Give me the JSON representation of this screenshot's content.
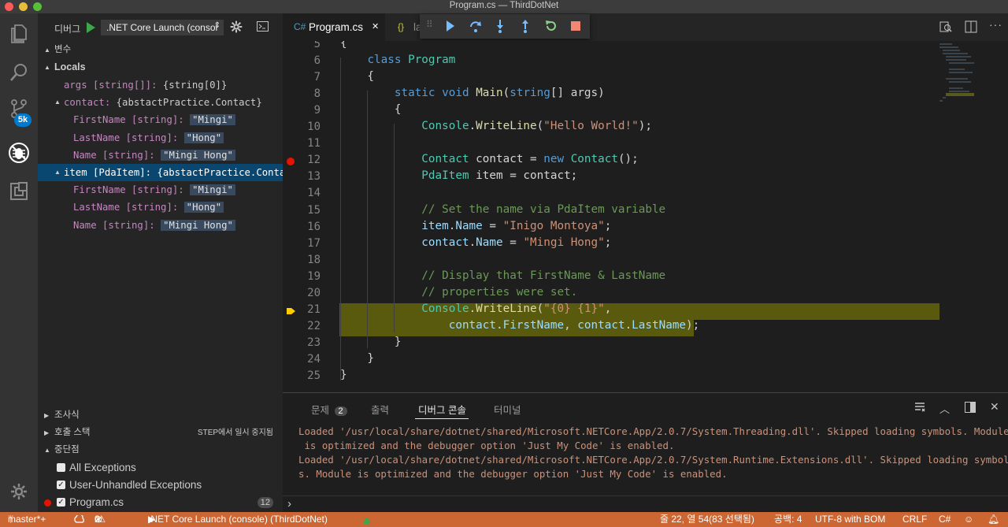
{
  "window": {
    "title": "Program.cs — ThirdDotNet"
  },
  "colors": {
    "accent": "#007acc",
    "status_bar": "#cc6633",
    "selection": "#094771",
    "current_line": "#5a5a0e"
  },
  "activity": {
    "icons": [
      "explorer-icon",
      "search-icon",
      "source-control-icon",
      "debug-icon",
      "extensions-icon",
      "settings-gear-icon"
    ],
    "scm_badge": "5k"
  },
  "debug_toolbar": {
    "label": "디버그",
    "configuration": ".NET Core Launch (consol"
  },
  "sidebar": {
    "variables_header": "변수",
    "locals_header": "Locals",
    "variables": [
      {
        "indent": 1,
        "expander": "",
        "name": "args [string[]]:",
        "value": "{string[0]}",
        "type": "plain"
      },
      {
        "indent": 1,
        "expander": "▲",
        "name": "contact:",
        "value": "{abstactPractice.Contact}",
        "type": "plain"
      },
      {
        "indent": 2,
        "expander": "",
        "name": "FirstName [string]:",
        "value": "\"Mingi\"",
        "type": "string"
      },
      {
        "indent": 2,
        "expander": "",
        "name": "LastName [string]:",
        "value": "\"Hong\"",
        "type": "string"
      },
      {
        "indent": 2,
        "expander": "",
        "name": "Name [string]:",
        "value": "\"Mingi Hong\"",
        "type": "string"
      },
      {
        "indent": 1,
        "expander": "▲",
        "name": "item [PdaItem]:",
        "value": "{abstactPractice.Contact}",
        "type": "plain",
        "selected": true
      },
      {
        "indent": 2,
        "expander": "",
        "name": "FirstName [string]:",
        "value": "\"Mingi\"",
        "type": "string"
      },
      {
        "indent": 2,
        "expander": "",
        "name": "LastName [string]:",
        "value": "\"Hong\"",
        "type": "string"
      },
      {
        "indent": 2,
        "expander": "",
        "name": "Name [string]:",
        "value": "\"Mingi Hong\"",
        "type": "string"
      }
    ],
    "watch_header": "조사식",
    "callstack_header": "호출 스택",
    "callstack_status": "STEP에서 일시 중지됨",
    "breakpoints_header": "중단점",
    "breakpoints": [
      {
        "label": "All Exceptions",
        "checked": false,
        "dot": false,
        "count": ""
      },
      {
        "label": "User-Unhandled Exceptions",
        "checked": true,
        "dot": false,
        "count": ""
      },
      {
        "label": "Program.cs",
        "checked": true,
        "dot": true,
        "count": "12"
      }
    ]
  },
  "editor": {
    "tabs": [
      {
        "label": "Program.cs",
        "icon": "csharp-file-icon",
        "active": true,
        "close": "✕"
      },
      {
        "label": "la",
        "icon": "json-file-icon",
        "active": false
      }
    ],
    "lines": [
      {
        "no": "5",
        "html": "{"
      },
      {
        "no": "6",
        "html": "    <span class=\"kw\">class</span> <span class=\"ty\">Program</span>"
      },
      {
        "no": "7",
        "html": "    {"
      },
      {
        "no": "8",
        "html": "        <span class=\"kw\">static</span> <span class=\"kw\">void</span> <span class=\"fn\">Main</span>(<span class=\"kw\">string</span>[] args)"
      },
      {
        "no": "9",
        "html": "        {"
      },
      {
        "no": "10",
        "html": "            <span class=\"ty\">Console</span>.<span class=\"fn\">WriteLine</span>(<span class=\"s\">\"Hello World!\"</span>);"
      },
      {
        "no": "11",
        "html": ""
      },
      {
        "no": "12",
        "html": "            <span class=\"ty\">Contact</span> contact = <span class=\"kw\">new</span> <span class=\"ty\">Contact</span>();",
        "breakpoint": true
      },
      {
        "no": "13",
        "html": "            <span class=\"ty\">PdaItem</span> item = contact;"
      },
      {
        "no": "14",
        "html": ""
      },
      {
        "no": "15",
        "html": "            <span class=\"c\">// Set the name via PdaItem variable</span>"
      },
      {
        "no": "16",
        "html": "            <span class=\"id\">item</span>.<span class=\"id\">Name</span> = <span class=\"s\">\"Inigo Montoya\"</span>;"
      },
      {
        "no": "17",
        "html": "            <span class=\"id\">contact</span>.<span class=\"id\">Name</span> = <span class=\"s\">\"Mingi Hong\"</span>;"
      },
      {
        "no": "18",
        "html": ""
      },
      {
        "no": "19",
        "html": "            <span class=\"c\">// Display that FirstName &amp; LastName</span>"
      },
      {
        "no": "20",
        "html": "            <span class=\"c\">// properties were set.</span>"
      },
      {
        "no": "21",
        "html": "            <span class=\"ty\">Console</span>.<span class=\"fn\">WriteLine</span>(<span class=\"s\">\"{0} {1}\"</span>,",
        "current": true
      },
      {
        "no": "22",
        "html": "                <span class=\"id\">contact</span>.<span class=\"id\">FirstName</span>, <span class=\"id\">contact</span>.<span class=\"id\">LastName</span>);",
        "current": true
      },
      {
        "no": "23",
        "html": "        }"
      },
      {
        "no": "24",
        "html": "    }"
      },
      {
        "no": "25",
        "html": "}"
      }
    ]
  },
  "panel": {
    "tabs": [
      {
        "label": "문제",
        "badge": "2"
      },
      {
        "label": "출력"
      },
      {
        "label": "디버그 콘솔",
        "active": true
      },
      {
        "label": "터미널"
      }
    ],
    "output": [
      "Loaded '/usr/local/share/dotnet/shared/Microsoft.NETCore.App/2.0.7/System.Threading.dll'. Skipped loading symbols. Module",
      " is optimized and the debugger option 'Just My Code' is enabled.",
      "Loaded '/usr/local/share/dotnet/shared/Microsoft.NETCore.App/2.0.7/System.Runtime.Extensions.dll'. Skipped loading symbol",
      "s. Module is optimized and the debugger option 'Just My Code' is enabled."
    ],
    "prompt": "›"
  },
  "status": {
    "branch": "master*+",
    "errors": "0",
    "warnings": "2",
    "launch": ".NET Core Launch (console) (ThirdDotNet)",
    "position": "줄 22, 열 54(83 선택됨)",
    "spaces": "공백: 4",
    "encoding": "UTF-8 with BOM",
    "eol": "CRLF",
    "language": "C#"
  }
}
